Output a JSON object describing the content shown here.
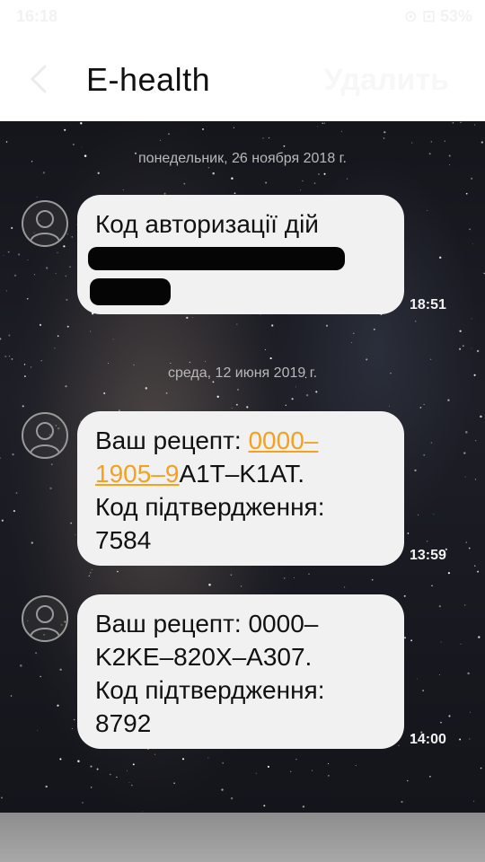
{
  "status_bar": {
    "time": "16:18",
    "right_text": "⊙ ⊡ 53%"
  },
  "header": {
    "title": "E-health",
    "delete_label": "Удалить"
  },
  "conversation": [
    {
      "date": "понедельник, 26 ноября 2018 г."
    },
    {
      "lines": [
        "Код авторизації дій"
      ],
      "redacted": true,
      "time": "18:51"
    },
    {
      "date": "среда, 12 июня 2019 г."
    },
    {
      "text_before": "Ваш рецепт: ",
      "link_part1": "0000–",
      "link_part2": "1905–9",
      "text_after": "A1T–K1AT.",
      "lines": [
        "Код підтвердження:",
        "7584"
      ],
      "time": "13:59"
    },
    {
      "lines": [
        "Ваш рецепт: 0000–",
        "K2KE–820X–A307.",
        "Код підтвердження:",
        "8792"
      ],
      "time": "14:00"
    }
  ]
}
